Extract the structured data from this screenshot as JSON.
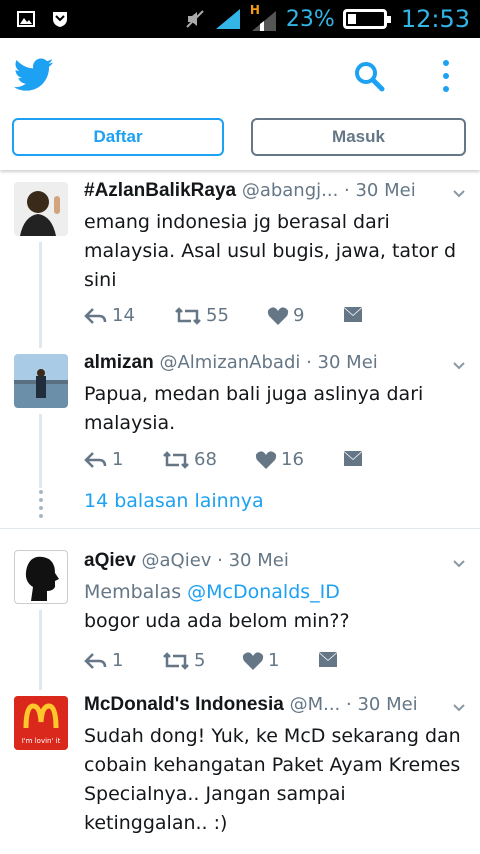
{
  "status_bar": {
    "battery": "23%",
    "time": "12:53",
    "battery_level": 0.23,
    "network_label": "H"
  },
  "header": {
    "logo_icon": "twitter-bird-icon",
    "brand_color": "#1da1f2",
    "signup_label": "Daftar",
    "login_label": "Masuk"
  },
  "tweets": [
    {
      "name": "#AzlanBalikRaya",
      "handle": "@abangj...",
      "date": "30 Mei",
      "text": "emang indonesia jg berasal dari malaysia. Asal usul bugis, jawa, tator d sini",
      "replies": "14",
      "retweets": "55",
      "likes": "9"
    },
    {
      "name": "almizan",
      "handle": "@AlmizanAbadi",
      "date": "30 Mei",
      "text": "Papua, medan bali juga aslinya dari malaysia.",
      "replies": "1",
      "retweets": "68",
      "likes": "16"
    }
  ],
  "more_replies": "14 balasan lainnya",
  "tweets2": [
    {
      "name": "aQiev",
      "handle": "@aQiev",
      "date": "30 Mei",
      "reply_prefix": "Membalas ",
      "reply_to": "@McDonalds_ID",
      "text": "bogor uda ada belom min??",
      "replies": "1",
      "retweets": "5",
      "likes": "1"
    },
    {
      "name": "McDonald's Indonesia",
      "handle": "@M...",
      "date": "30 Mei",
      "text": "Sudah dong! Yuk, ke McD sekarang dan cobain kehangatan Paket Ayam Kremes Specialnya.. Jangan sampai ketinggalan.. :)",
      "avatar_tagline": "I'm lovin' it"
    }
  ]
}
